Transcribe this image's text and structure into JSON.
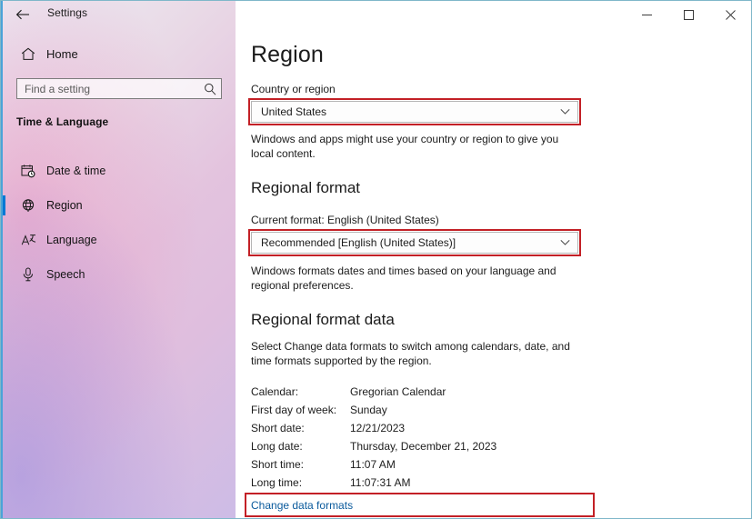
{
  "window": {
    "app_title": "Settings",
    "back_icon": "back-arrow-icon",
    "minimize_label": "Minimize",
    "maximize_label": "Maximize",
    "close_label": "Close"
  },
  "sidebar": {
    "home": {
      "label": "Home",
      "icon": "home-icon"
    },
    "search": {
      "placeholder": "Find a setting",
      "value": "",
      "icon": "search-icon"
    },
    "group_title": "Time & Language",
    "items": [
      {
        "label": "Date & time",
        "icon": "calendar-clock-icon",
        "selected": false
      },
      {
        "label": "Region",
        "icon": "globe-region-icon",
        "selected": true
      },
      {
        "label": "Language",
        "icon": "language-icon",
        "selected": false
      },
      {
        "label": "Speech",
        "icon": "microphone-icon",
        "selected": false
      }
    ]
  },
  "main": {
    "page_title": "Region",
    "country_label": "Country or region",
    "country_value": "United States",
    "country_desc": "Windows and apps might use your country or region to give you local content.",
    "regional_format_heading": "Regional format",
    "current_format_label": "Current format: English (United States)",
    "regional_format_value": "Recommended [English (United States)]",
    "regional_format_desc": "Windows formats dates and times based on your language and regional preferences.",
    "regional_data_heading": "Regional format data",
    "regional_data_desc": "Select Change data formats to switch among calendars, date, and time formats supported by the region.",
    "data_rows": [
      {
        "key": "Calendar:",
        "value": "Gregorian Calendar"
      },
      {
        "key": "First day of week:",
        "value": "Sunday"
      },
      {
        "key": "Short date:",
        "value": "12/21/2023"
      },
      {
        "key": "Long date:",
        "value": "Thursday, December 21, 2023"
      },
      {
        "key": "Short time:",
        "value": "11:07 AM"
      },
      {
        "key": "Long time:",
        "value": "11:07:31 AM"
      }
    ],
    "change_formats_link": "Change data formats",
    "chevron_icon": "chevron-down-icon"
  },
  "colors": {
    "highlight": "#c32026",
    "accent": "#0078d4",
    "link": "#0a5a9c",
    "window_border": "#7fb7c9"
  }
}
